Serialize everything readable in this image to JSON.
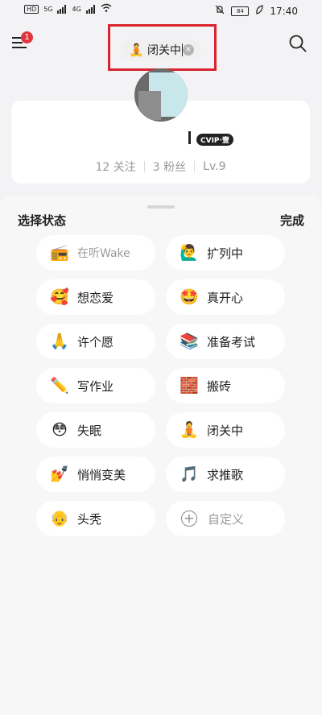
{
  "status_bar": {
    "hd1": "HD",
    "hd2": "HD",
    "net1": "5G",
    "net2": "4G",
    "battery": "84",
    "time": "17:40"
  },
  "header": {
    "menu_badge": "1",
    "pill": {
      "emoji": "🧘",
      "text": "闭关中",
      "clear": "×"
    }
  },
  "profile": {
    "vip_badge": "CVIP·壹",
    "stats": [
      {
        "num": "12",
        "label": "关注"
      },
      {
        "num": "3",
        "label": "粉丝"
      },
      {
        "num": "",
        "label": "Lv.9"
      }
    ]
  },
  "sheet": {
    "title": "选择状态",
    "done": "完成",
    "items": [
      {
        "emoji": "📻",
        "label": "在听Wake",
        "muted": true
      },
      {
        "emoji": "🙋‍♂️",
        "label": "扩列中"
      },
      {
        "emoji": "🥰",
        "label": "想恋爱"
      },
      {
        "emoji": "🤩",
        "label": "真开心"
      },
      {
        "emoji": "🙏",
        "label": "许个愿"
      },
      {
        "emoji": "📚",
        "label": "准备考试"
      },
      {
        "emoji": "✏️",
        "label": "写作业"
      },
      {
        "emoji": "🧱",
        "label": "搬砖"
      },
      {
        "emoji": "😳",
        "label": "失眠"
      },
      {
        "emoji": "🧘",
        "label": "闭关中"
      },
      {
        "emoji": "💅",
        "label": "悄悄变美"
      },
      {
        "emoji": "🎵",
        "label": "求推歌"
      },
      {
        "emoji": "👴",
        "label": "头秃"
      },
      {
        "emoji": "+",
        "label": "自定义",
        "custom": true
      }
    ]
  }
}
